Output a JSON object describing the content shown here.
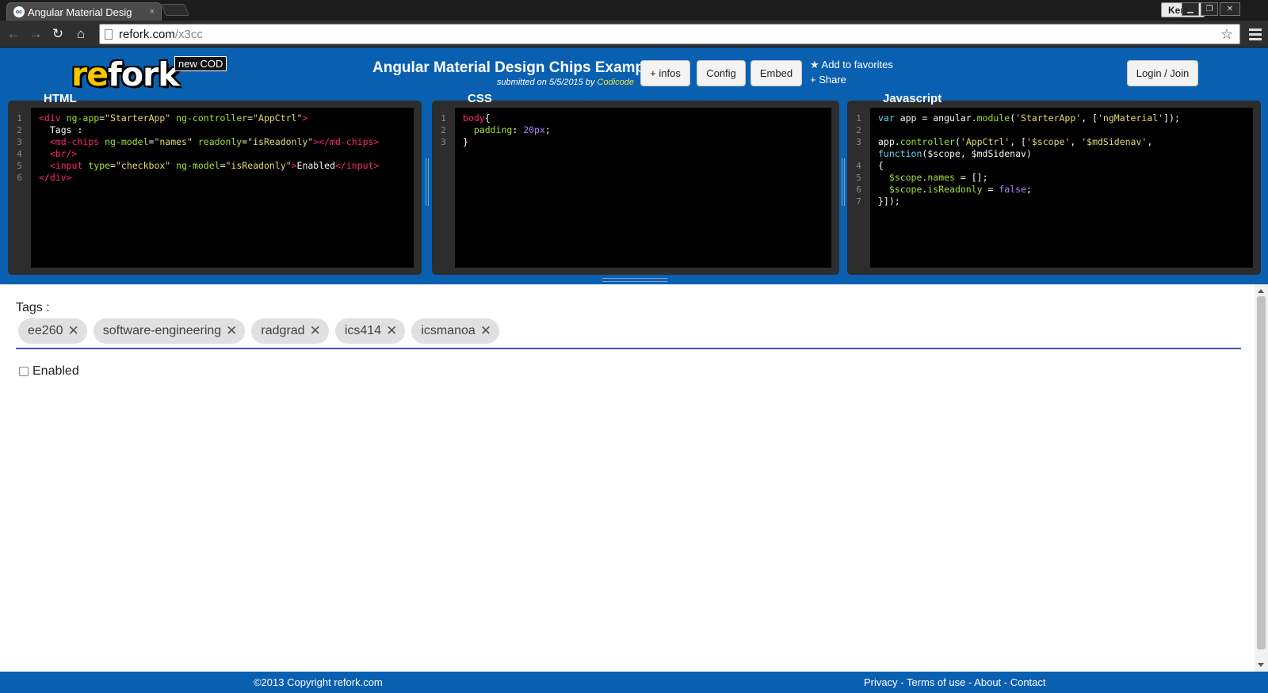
{
  "browser": {
    "tab_title": "Angular Material Desig",
    "favicon_text": "oc",
    "close_glyph": "×",
    "user": "Kenny",
    "url_host": "refork.com",
    "url_path": "/x3cc"
  },
  "header": {
    "logo_part1": "re",
    "logo_part2": "fork",
    "badge": "new COD",
    "title": "Angular Material Design Chips Example",
    "submitted_prefix": "submitted on 5/5/2015 by ",
    "author": "Codicode",
    "buttons": {
      "infos": "+ infos",
      "config": "Config",
      "embed": "Embed"
    },
    "favorite": "★ Add to favorites",
    "share": "+ Share",
    "login": "Login / Join"
  },
  "editors": {
    "html": {
      "title": "HTML",
      "line_numbers": "1\n2\n3\n4\n5\n6"
    },
    "css": {
      "title": "CSS",
      "line_numbers": "1\n2\n3"
    },
    "js": {
      "title": "Javascript",
      "line_numbers": "1\n2\n3\n\n4\n5\n6\n7"
    }
  },
  "preview": {
    "tags_label": "Tags :",
    "chips": [
      "ee260",
      "software-engineering",
      "radgrad",
      "ics414",
      "icsmanoa"
    ],
    "remove_glyph": "✕",
    "checkbox_label": "Enabled",
    "checkbox_checked": false
  },
  "footer": {
    "copyright": "©2013 Copyright refork.com",
    "links": "Privacy - Terms of use - About - Contact"
  },
  "colors": {
    "brand_blue": "#0a60b0",
    "logo_yellow": "#f7c600",
    "chip_underline": "#3f51b5"
  }
}
